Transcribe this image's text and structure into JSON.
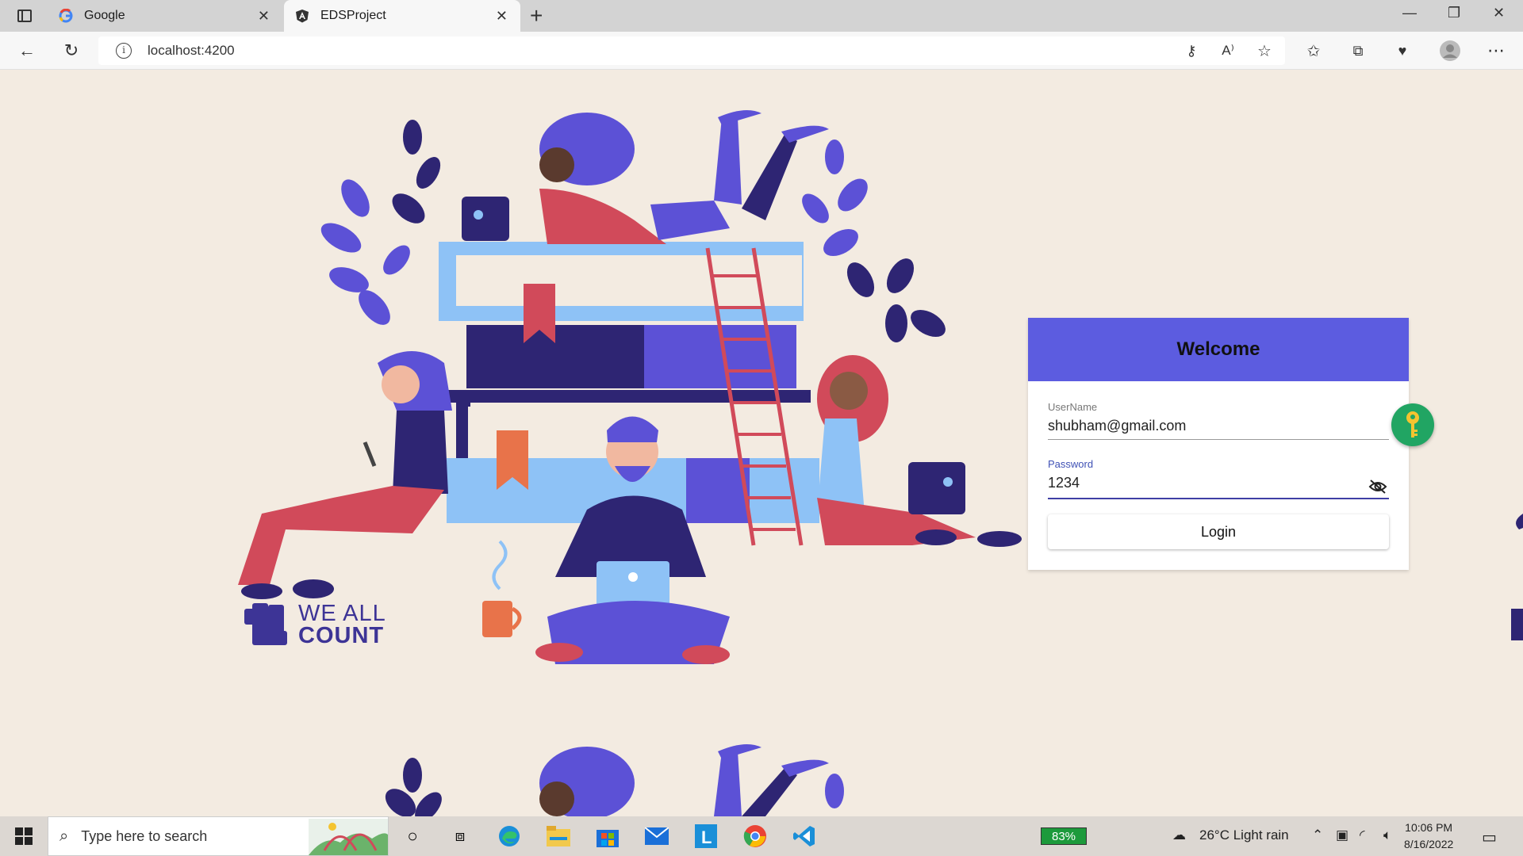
{
  "browser": {
    "tabs": [
      {
        "title": "Google",
        "favicon": "google-icon",
        "active": false
      },
      {
        "title": "EDSProject",
        "favicon": "angular-icon",
        "active": true
      }
    ],
    "url": "localhost:4200"
  },
  "illustration": {
    "logo_text_line1": "WE ALL",
    "logo_text_line2": "COUNT"
  },
  "login": {
    "title": "Welcome",
    "username_label": "UserName",
    "username_value": "shubham@gmail.com",
    "password_label": "Password",
    "password_value": "1234",
    "login_button": "Login"
  },
  "taskbar": {
    "search_placeholder": "Type here to search",
    "battery": "83%",
    "weather": "26°C  Light rain",
    "time": "10:06 PM",
    "date": "8/16/2022"
  },
  "colors": {
    "accent": "#5c5ce0",
    "page_bg": "#f3ebe1",
    "fab": "#21a563"
  }
}
